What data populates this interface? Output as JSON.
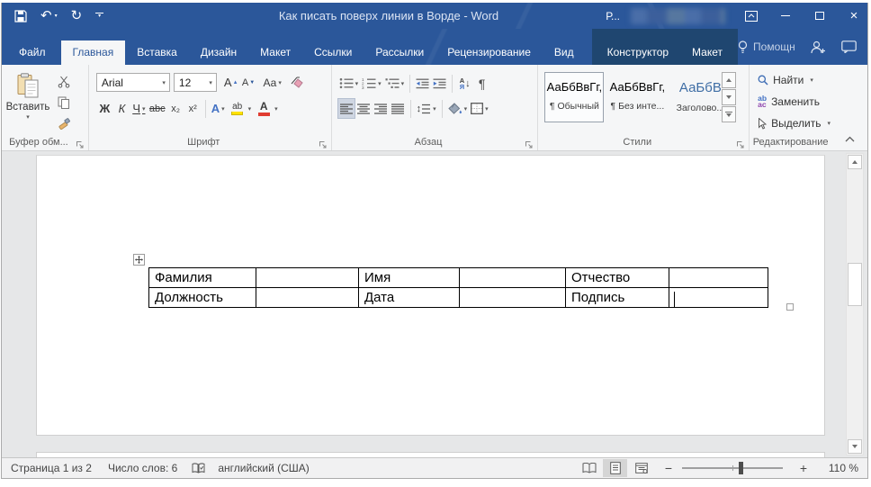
{
  "colors": {
    "titlebar": "#2b579a",
    "contextual_tab_bg": "#1f4670",
    "accent": "#2b579a",
    "highlight_yellow": "#ffe100",
    "font_color_red": "#e03c31"
  },
  "titlebar": {
    "title": "Как писать поверх линии в Ворде - Word",
    "account": "Р..."
  },
  "tabs": {
    "file": "Файл",
    "items": [
      "Главная",
      "Вставка",
      "Дизайн",
      "Макет",
      "Ссылки",
      "Рассылки",
      "Рецензирование",
      "Вид"
    ],
    "contextual": [
      "Конструктор",
      "Макет"
    ],
    "help": "Помощн"
  },
  "ribbon": {
    "clipboard": {
      "paste": "Вставить",
      "group": "Буфер обм..."
    },
    "font": {
      "family": "Arial",
      "size": "12",
      "group": "Шрифт"
    },
    "paragraph": {
      "group": "Абзац"
    },
    "styles": {
      "group": "Стили",
      "cards": [
        {
          "preview": "АаБбВвГг,",
          "name": "¶ Обычный"
        },
        {
          "preview": "АаБбВвГг,",
          "name": "¶ Без инте..."
        },
        {
          "preview": "АаБбВ",
          "name": "Заголово..."
        }
      ]
    },
    "editing": {
      "find": "Найти",
      "replace": "Заменить",
      "select": "Выделить",
      "group": "Редактирование"
    }
  },
  "glyphs": {
    "bold": "Ж",
    "italic": "К",
    "underline": "Ч",
    "strikethrough": "abc",
    "subscript": "x₂",
    "superscript": "x²",
    "case": "Аа",
    "grow": "А",
    "shrink": "А",
    "text_effects": "А",
    "highlight": "ab",
    "font_color": "А",
    "sort_first": "А",
    "sort_last": "Я",
    "pilcrow": "¶",
    "replace_top": "ab",
    "replace_bottom": "ac",
    "undo": "↶",
    "redo": "↻",
    "close": "×",
    "zoom_out": "−",
    "zoom_in": "+"
  },
  "document": {
    "table": {
      "rows": [
        [
          "Фамилия",
          "",
          "Имя",
          "",
          "Отчество",
          ""
        ],
        [
          "Должность",
          "",
          "Дата",
          "",
          "Подпись",
          ""
        ]
      ]
    }
  },
  "status": {
    "page": "Страница 1 из 2",
    "words": "Число слов: 6",
    "language": "английский (США)",
    "zoom": "110 %"
  }
}
